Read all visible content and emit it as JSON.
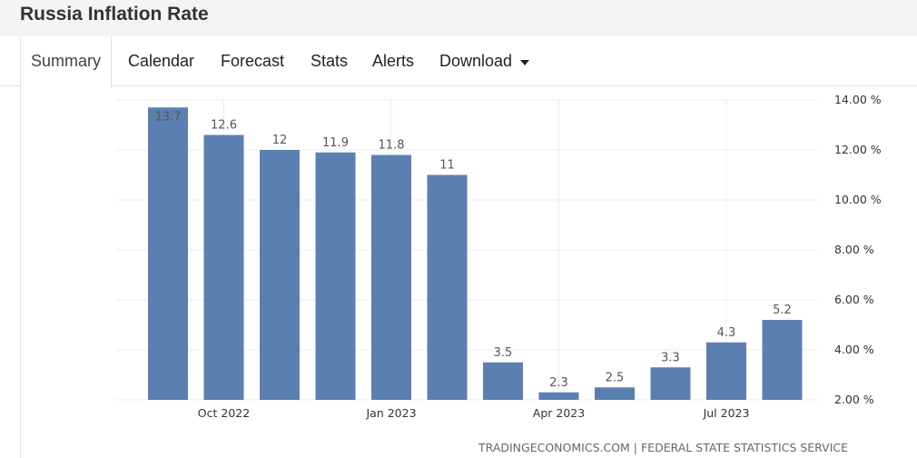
{
  "header": {
    "title": "Russia Inflation Rate"
  },
  "tabs": [
    {
      "label": "Summary",
      "active": true
    },
    {
      "label": "Calendar"
    },
    {
      "label": "Forecast"
    },
    {
      "label": "Stats"
    },
    {
      "label": "Alerts"
    },
    {
      "label": "Download",
      "has_dropdown": true
    }
  ],
  "icons": {
    "download_caret": "caret-down-icon"
  },
  "colors": {
    "bar": "#5b7fb1",
    "header_bg": "#f4f4f4"
  },
  "source": "TRADINGECONOMICS.COM | FEDERAL STATE STATISTICS SERVICE",
  "chart_data": {
    "type": "bar",
    "categories": [
      "Sep 2022",
      "Oct 2022",
      "Nov 2022",
      "Dec 2022",
      "Jan 2023",
      "Feb 2023",
      "Mar 2023",
      "Apr 2023",
      "May 2023",
      "Jun 2023",
      "Jul 2023",
      "Aug 2023"
    ],
    "values": [
      13.7,
      12.6,
      12,
      11.9,
      11.8,
      11,
      3.5,
      2.3,
      2.5,
      3.3,
      4.3,
      5.2
    ],
    "data_labels": [
      "13.7",
      "12.6",
      "12",
      "11.9",
      "11.8",
      "11",
      "3.5",
      "2.3",
      "2.5",
      "3.3",
      "4.3",
      "5.2"
    ],
    "x_tick_labels": [
      {
        "label": "Oct 2022",
        "index": 1
      },
      {
        "label": "Jan 2023",
        "index": 4
      },
      {
        "label": "Apr 2023",
        "index": 7
      },
      {
        "label": "Jul 2023",
        "index": 10
      }
    ],
    "y_ticks": [
      2,
      4,
      6,
      8,
      10,
      12,
      14
    ],
    "y_tick_labels": [
      "2.00 %",
      "4.00 %",
      "6.00 %",
      "8.00 %",
      "10.00 %",
      "12.00 %",
      "14.00 %"
    ],
    "ylim": [
      2,
      14
    ],
    "y_axis_side": "right",
    "grid": true,
    "legend": "none",
    "title": "",
    "xlabel": "",
    "ylabel": ""
  }
}
